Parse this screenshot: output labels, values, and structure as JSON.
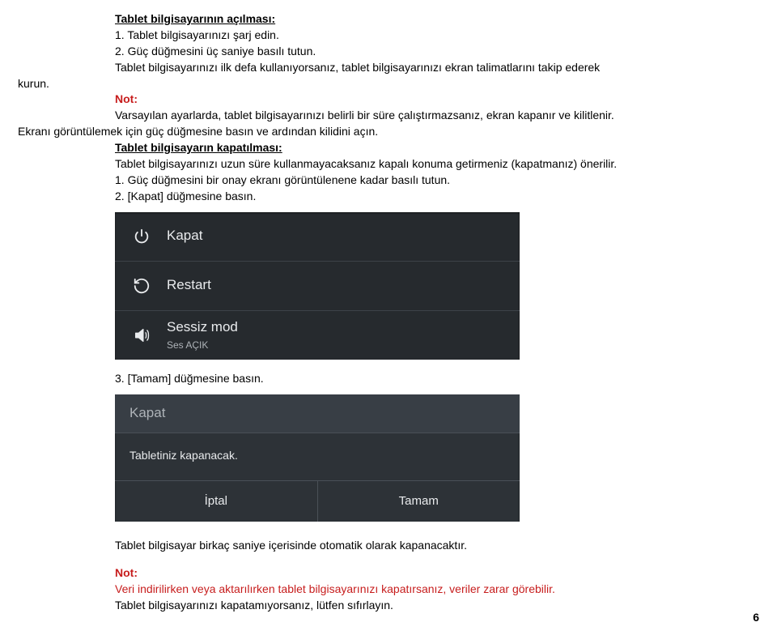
{
  "section_open": {
    "heading": "Tablet bilgisayarının açılması:",
    "step1": "1. Tablet bilgisayarınızı şarj edin.",
    "step2": "2. Güç düğmesini üç saniye basılı tutun.",
    "setup_line": "Tablet bilgisayarınızı ilk defa kullanıyorsanız, tablet bilgisayarınızı ekran talimatlarını takip ederek",
    "setup_kurun": "kurun.",
    "note_label": "Not:",
    "note_text": "Varsayılan ayarlarda, tablet bilgisayarınızı belirli bir süre çalıştırmazsanız, ekran kapanır ve kilitlenir.",
    "unlock_line": "Ekranı görüntülemek için güç düğmesine basın ve ardından kilidini açın."
  },
  "section_close": {
    "heading": "Tablet bilgisayarın kapatılması:",
    "recommend": "Tablet bilgisayarınızı uzun süre kullanmayacaksanız kapalı konuma getirmeniz (kapatmanız) önerilir.",
    "step1": "1. Güç düğmesini bir onay ekranı görüntülenene kadar basılı tutun.",
    "step2": "2. [Kapat] düğmesine basın."
  },
  "power_menu": {
    "rows": [
      {
        "icon": "power-icon",
        "label": "Kapat",
        "sub": ""
      },
      {
        "icon": "restart-icon",
        "label": "Restart",
        "sub": ""
      },
      {
        "icon": "volume-icon",
        "label": "Sessiz mod",
        "sub": "Ses AÇIK"
      }
    ]
  },
  "step3": "3. [Tamam] düğmesine basın.",
  "dialog": {
    "title": "Kapat",
    "body": "Tabletiniz kapanacak.",
    "cancel": "İptal",
    "ok": "Tamam"
  },
  "after": {
    "auto_off": "Tablet bilgisayar birkaç saniye içerisinde otomatik olarak kapanacaktır.",
    "note_label": "Not:",
    "note_danger": "Veri indirilirken veya aktarılırken tablet bilgisayarınızı kapatırsanız, veriler zarar görebilir.",
    "reset_line": "Tablet bilgisayarınızı kapatamıyorsanız, lütfen sıfırlayın."
  },
  "page_number": "6"
}
